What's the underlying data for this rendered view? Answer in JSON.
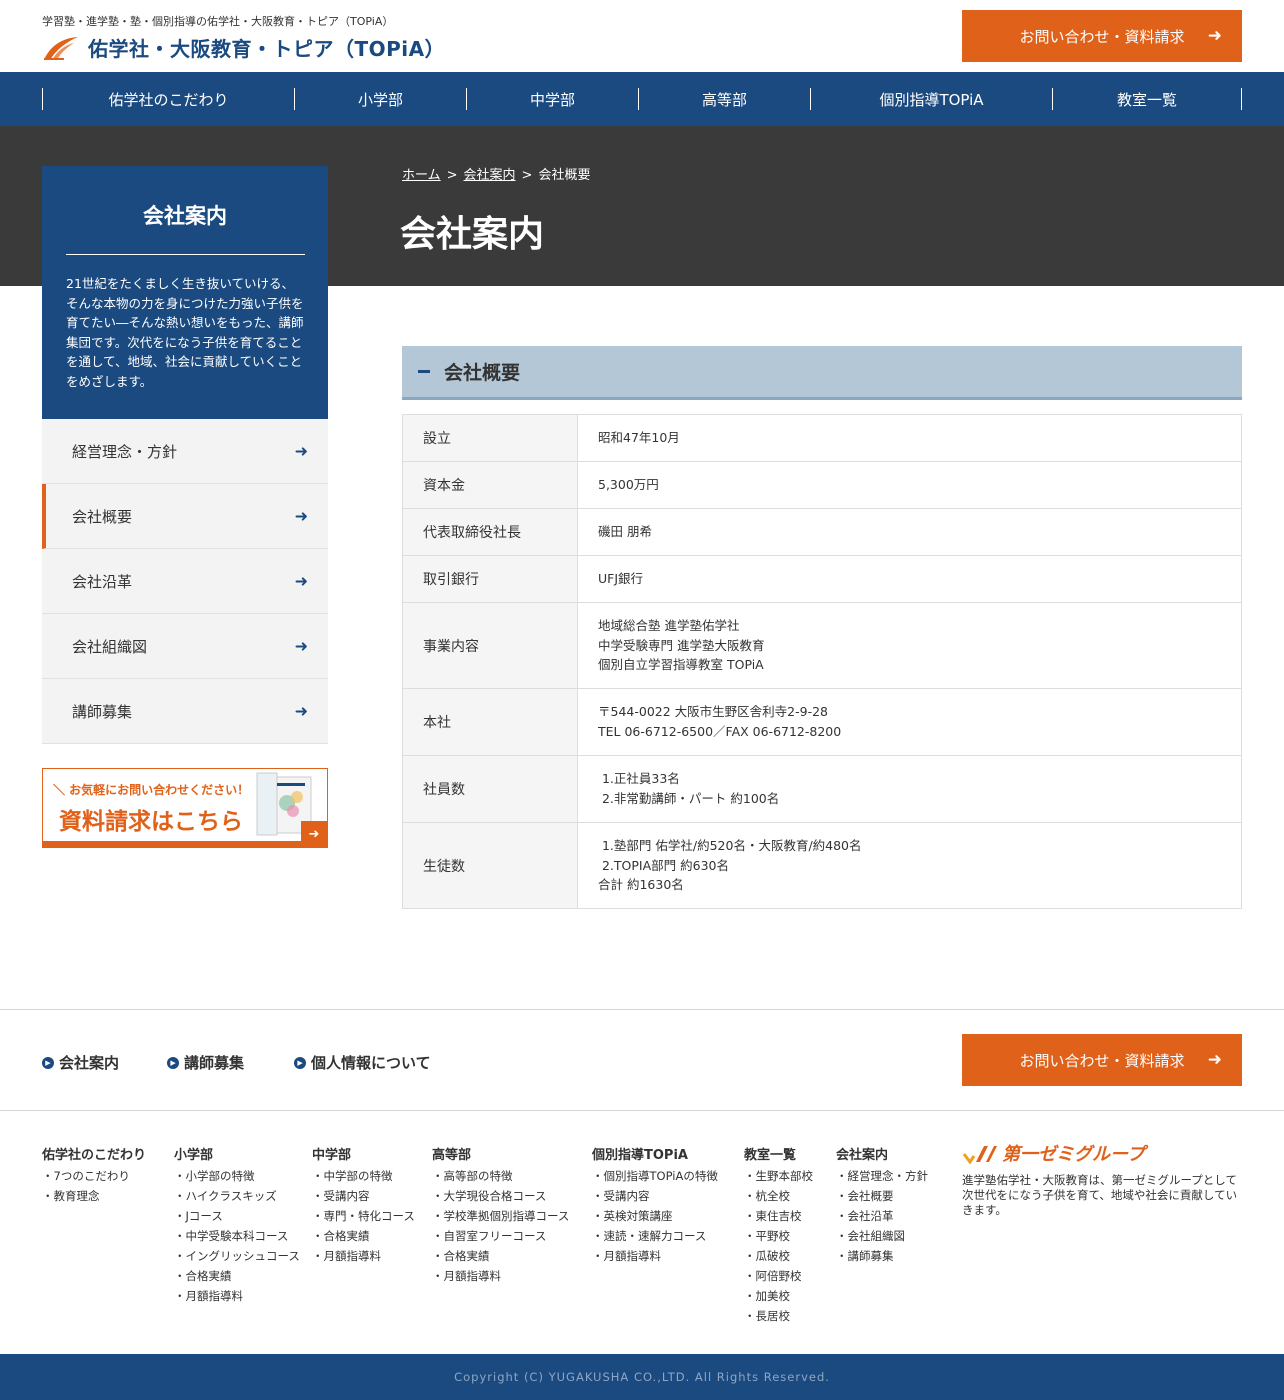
{
  "header": {
    "tagline": "学習塾・進学塾・塾・個別指導の佑学社・大阪教育・トピア（TOPiA）",
    "logo_text": "佑学社・大阪教育・トピア（TOPiA）",
    "cta_label": "お問い合わせ・資料請求"
  },
  "nav": {
    "items": [
      {
        "label": "佑学社のこだわり"
      },
      {
        "label": "小学部"
      },
      {
        "label": "中学部"
      },
      {
        "label": "高等部"
      },
      {
        "label": "個別指導TOPiA"
      },
      {
        "label": "教室一覧"
      }
    ]
  },
  "breadcrumb": {
    "home": "ホーム",
    "separator": ">",
    "company": "会社案内",
    "current": "会社概要"
  },
  "page_title": "会社案内",
  "sidebar": {
    "title": "会社案内",
    "description": "21世紀をたくましく生き抜いていける、そんな本物の力を身につけた力強い子供を育てたい―そんな熱い想いをもった、講師集団です。次代をになう子供を育てることを通して、地域、社会に貢献していくことをめざします。",
    "items": [
      {
        "label": "経営理念・方針"
      },
      {
        "label": "会社概要"
      },
      {
        "label": "会社沿革"
      },
      {
        "label": "会社組織図"
      },
      {
        "label": "講師募集"
      }
    ],
    "arrow": "➜",
    "banner": {
      "sub": "＼ お気軽にお問い合わせください！",
      "main": "資料請求はこちら"
    }
  },
  "section": {
    "title": "会社概要"
  },
  "company_table": {
    "rows": [
      {
        "label": "設立",
        "lines": [
          "昭和47年10月"
        ]
      },
      {
        "label": "資本金",
        "lines": [
          "5,300万円"
        ]
      },
      {
        "label": "代表取締役社長",
        "lines": [
          "磯田 朋希"
        ]
      },
      {
        "label": "取引銀行",
        "lines": [
          "UFJ銀行"
        ]
      },
      {
        "label": "事業内容",
        "lines": [
          "地域総合塾 進学塾佑学社",
          "中学受験専門 進学塾大阪教育",
          "個別自立学習指導教室 TOPiA"
        ]
      },
      {
        "label": "本社",
        "lines": [
          "〒544-0022 大阪市生野区舎利寺2-9-28",
          "TEL 06-6712-6500／FAX 06-6712-8200"
        ]
      },
      {
        "label": "社員数",
        "lines": [
          " 1.正社員33名",
          " 2.非常勤講師・パート 約100名"
        ]
      },
      {
        "label": "生徒数",
        "lines": [
          " 1.塾部門 佑学社/約520名・大阪教育/約480名",
          " 2.TOPIA部門 約630名",
          "合計 約1630名"
        ]
      }
    ]
  },
  "footer": {
    "links": [
      {
        "label": "会社案内"
      },
      {
        "label": "講師募集"
      },
      {
        "label": "個人情報について"
      }
    ],
    "cta_label": "お問い合わせ・資料請求",
    "sitemap": [
      {
        "heading": "佑学社のこだわり",
        "items": [
          "・7つのこだわり",
          "・教育理念"
        ]
      },
      {
        "heading": "小学部",
        "items": [
          "・小学部の特徴",
          "・ハイクラスキッズ",
          "・Jコース",
          "・中学受験本科コース",
          "・イングリッシュコース",
          "・合格実績",
          "・月額指導料"
        ]
      },
      {
        "heading": "中学部",
        "items": [
          "・中学部の特徴",
          "・受講内容",
          "・専門・特化コース",
          "・合格実績",
          "・月額指導料"
        ]
      },
      {
        "heading": "高等部",
        "items": [
          "・高等部の特徴",
          "・大学現役合格コース",
          "・学校準拠個別指導コース",
          "・自習室フリーコース",
          "・合格実績",
          "・月額指導料"
        ]
      },
      {
        "heading": "個別指導TOPiA",
        "items": [
          "・個別指導TOPiAの特徴",
          "・受講内容",
          "・英検対策講座",
          "・速読・速解力コース",
          "・月額指導料"
        ]
      },
      {
        "heading": "教室一覧",
        "items": [
          "・生野本部校",
          "・杭全校",
          "・東住吉校",
          "・平野校",
          "・瓜破校",
          "・阿倍野校",
          "・加美校",
          "・長居校"
        ]
      },
      {
        "heading": "会社案内",
        "items": [
          "・経営理念・方針",
          "・会社概要",
          "・会社沿革",
          "・会社組織図",
          "・講師募集"
        ]
      }
    ],
    "group_name": "第一ゼミグループ",
    "group_desc": "進学塾佑学社・大阪教育は、第一ゼミグループとして次世代をになう子供を育て、地域や社会に貢献していきます。",
    "copyright": "Copyright (C) YUGAKUSHA CO.,LTD. All Rights Reserved."
  },
  "colors": {
    "brand_blue": "#1b4a80",
    "accent_orange": "#e0621a",
    "hero_dark": "#3a3a3a",
    "section_head": "#b4c7d6"
  }
}
